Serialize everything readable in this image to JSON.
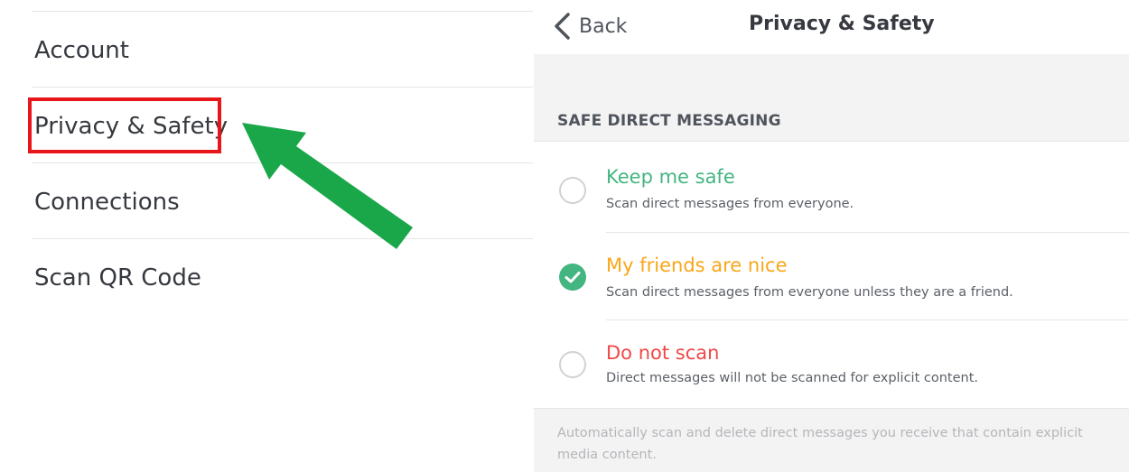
{
  "settings_menu": {
    "items": [
      {
        "label": "Account"
      },
      {
        "label": "Privacy & Safety"
      },
      {
        "label": "Connections"
      },
      {
        "label": "Scan QR Code"
      }
    ],
    "highlighted_item": "Privacy & Safety"
  },
  "annotation": {
    "highlight_color": "#e8161b",
    "arrow_color": "#1aa74a"
  },
  "nav": {
    "back_label": "Back",
    "title": "Privacy & Safety"
  },
  "safe_dm": {
    "section_title": "SAFE DIRECT MESSAGING",
    "options": [
      {
        "title": "Keep me safe",
        "description": "Scan direct messages from everyone.",
        "selected": false,
        "color": "#43b581"
      },
      {
        "title": "My friends are nice",
        "description": "Scan direct messages from everyone unless they are a friend.",
        "selected": true,
        "color": "#faa61a"
      },
      {
        "title": "Do not scan",
        "description": "Direct messages will not be scanned for explicit content.",
        "selected": false,
        "color": "#f04747"
      }
    ],
    "footer": "Automatically scan and delete direct messages you receive that contain explicit media content."
  },
  "icons": {
    "back": "chevron-left-icon",
    "checked": "check-icon"
  }
}
